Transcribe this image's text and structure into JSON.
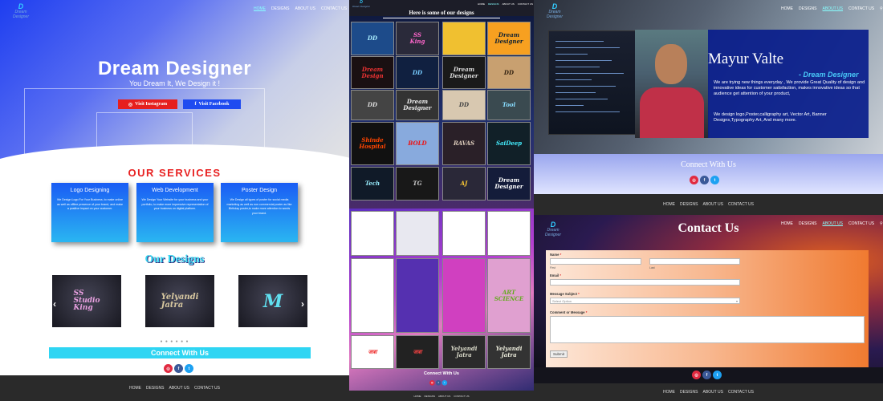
{
  "brand": {
    "logo_mark": "D",
    "logo_text": "Dream Designer"
  },
  "nav": {
    "home": "HOME",
    "designs": "DESIGNS",
    "about": "ABOUT US",
    "contact": "CONTACT US",
    "search_icon": "search-icon"
  },
  "hero": {
    "title": "Dream Designer",
    "tagline": "You Dream It, We Design it !",
    "instagram_button": "Visit Instagram",
    "facebook_button": "Visit Facebook"
  },
  "services": {
    "heading": "OUR SERVICES",
    "items": [
      {
        "title": "Logo Designing",
        "text": "We Design Logo For Your Business, to make online as well as offline presence of your brand, and make a positive impact on your customer."
      },
      {
        "title": "Web Development",
        "text": "We Design Your Website for your business and your portfolio, to make more impressive representation of your business on digital platform."
      },
      {
        "title": "Poster Design",
        "text": "We Design all types of poster for social media marketing as well as non commercial poster as like Birthday poster,to make more attention to words your brand."
      }
    ]
  },
  "designs": {
    "heading": "Our Designs",
    "slides": [
      {
        "text": "SS\nStudio\nKing",
        "color": "#e8a0e0"
      },
      {
        "text": "Yelyandi\nJatra",
        "color": "#d8c8a0"
      },
      {
        "text": "M",
        "color": "#60e0f0"
      }
    ],
    "prev_icon": "chevron-left-icon",
    "next_icon": "chevron-right-icon",
    "dots": "● ● ● ● ● ●"
  },
  "connect": {
    "heading": "Connect With Us"
  },
  "gallery": {
    "heading": "Here is some of our designs",
    "tiles": [
      {
        "text": "DD",
        "bg": "#1d4b8a",
        "fg": "#aef"
      },
      {
        "text": "SS\nKing",
        "bg": "#2a2a3a",
        "fg": "#f6c"
      },
      {
        "text": "",
        "bg": "#f0c030",
        "fg": "#000"
      },
      {
        "text": "Dream\nDesigner",
        "bg": "#f7a020",
        "fg": "#123"
      },
      {
        "text": "Dream\nDesign",
        "bg": "#1a1012",
        "fg": "#e33"
      },
      {
        "text": "DD",
        "bg": "#102040",
        "fg": "#7cf"
      },
      {
        "text": "Dream\nDesigner",
        "bg": "#1a1a1a",
        "fg": "#ddd"
      },
      {
        "text": "DD",
        "bg": "#c8a070",
        "fg": "#321"
      },
      {
        "text": "DD",
        "bg": "#444",
        "fg": "#ddd"
      },
      {
        "text": "Dream\nDesigner",
        "bg": "#333",
        "fg": "#eee"
      },
      {
        "text": "DD",
        "bg": "#d8c8b0",
        "fg": "#444"
      },
      {
        "text": "Tool",
        "bg": "#3a4a50",
        "fg": "#8df"
      },
      {
        "text": "Shinde\nHospital",
        "bg": "#111",
        "fg": "#f40"
      },
      {
        "text": "BOLD",
        "bg": "#8ad",
        "fg": "#e11"
      },
      {
        "text": "RAVAS",
        "bg": "#2a2028",
        "fg": "#dcb"
      },
      {
        "text": "SaiDeep",
        "bg": "#112028",
        "fg": "#4ef"
      },
      {
        "text": "Tech",
        "bg": "#101a28",
        "fg": "#9ef"
      },
      {
        "text": "TG",
        "bg": "#181818",
        "fg": "#ccc"
      },
      {
        "text": "AJ",
        "bg": "#2a2838",
        "fg": "#fc3"
      },
      {
        "text": "Dream\nDesigner",
        "bg": "#141c3a",
        "fg": "#fff"
      },
      {
        "text": "",
        "bg": "#fff",
        "fg": "#c3a"
      },
      {
        "text": "",
        "bg": "#e8e8f0",
        "fg": "#558"
      },
      {
        "text": "",
        "bg": "#fff",
        "fg": "#f60"
      },
      {
        "text": "",
        "bg": "#fff",
        "fg": "#f90"
      },
      {
        "text": "",
        "bg": "#fff",
        "fg": "#e21"
      },
      {
        "text": "",
        "bg": "#5530b0",
        "fg": "#fff"
      },
      {
        "text": "",
        "bg": "#d040c0",
        "fg": "#fc0"
      },
      {
        "text": "ART\nSCIENCE",
        "bg": "#e0a0d0",
        "fg": "#6a2"
      },
      {
        "text": "जत्रा",
        "bg": "#fff",
        "fg": "#e22"
      },
      {
        "text": "जत्रा",
        "bg": "#222",
        "fg": "#f44"
      },
      {
        "text": "Yelyandi\nJatra",
        "bg": "#2a2a2a",
        "fg": "#ddc"
      },
      {
        "text": "Yelyandi\nJatra",
        "bg": "#333",
        "fg": "#eed"
      }
    ],
    "connect": "Connect With Us"
  },
  "about": {
    "name": "Mayur Valte",
    "subtitle": "- Dream Designer",
    "para1": "We are trying new things everyday , We provide Great Quality of design and innovative ideas for customer satisfaction, makes innovative ideas so that audience get attention of your product,",
    "para2": "We design logo,Poster,calligraphy art, Vector Art, Banner Designs,Typography Art, And many more.",
    "connect": "Connect With Us"
  },
  "contact": {
    "title": "Contact Us",
    "name_label": "Name",
    "first_label": "First",
    "last_label": "Last",
    "email_label": "Email",
    "subject_label": "Message Subject",
    "subject_placeholder": "Select Option",
    "message_label": "Comment or Message",
    "submit": "Submit"
  }
}
